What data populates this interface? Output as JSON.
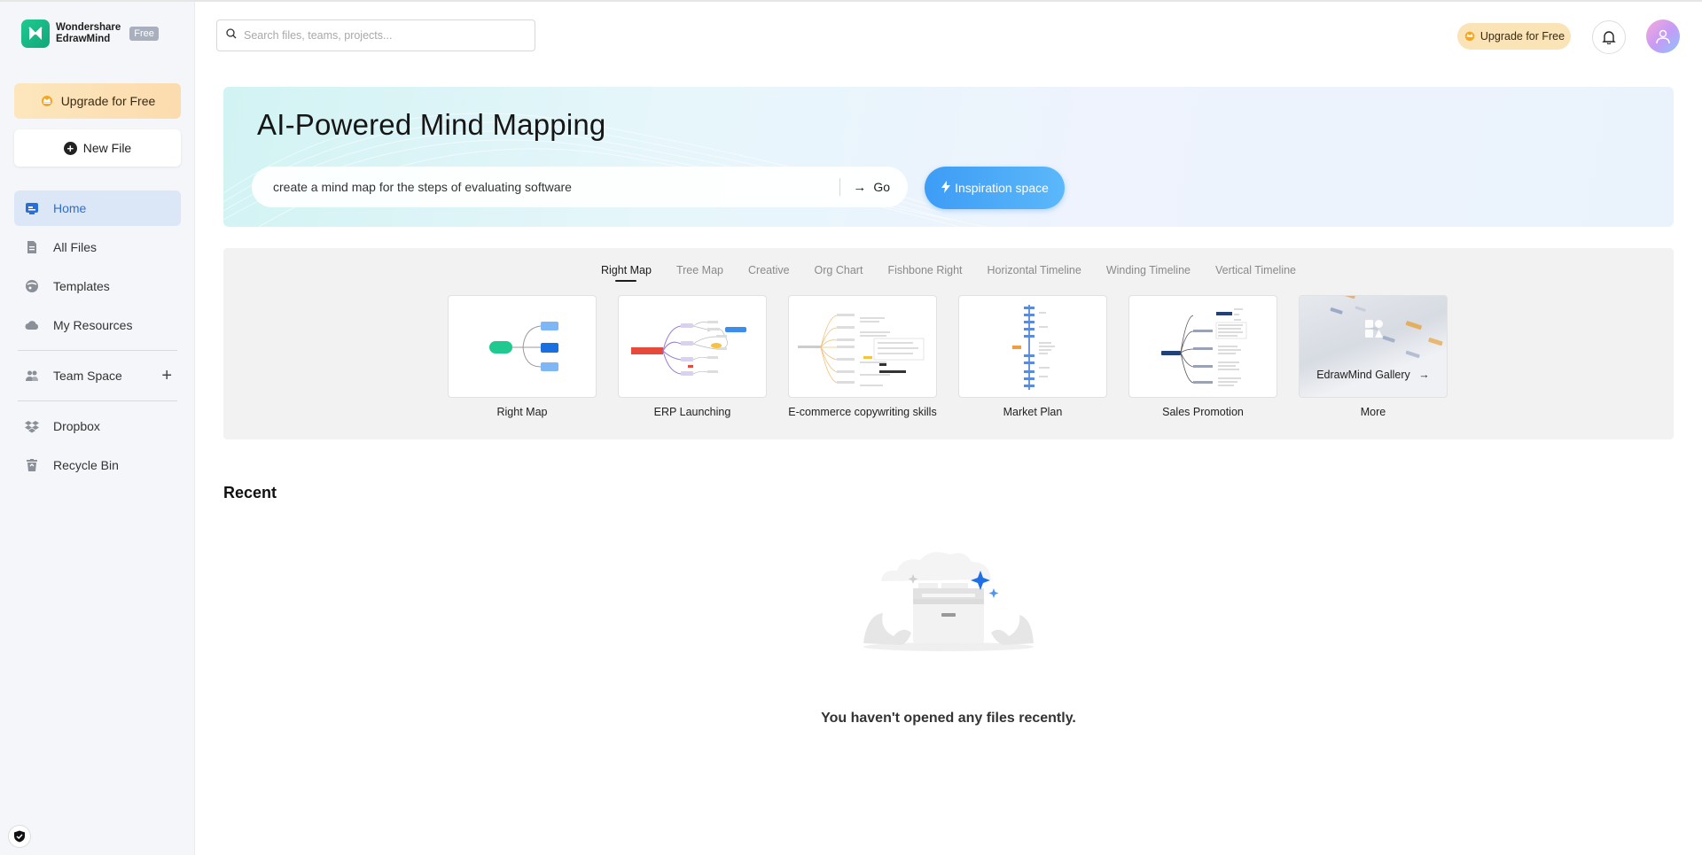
{
  "brand": {
    "line1": "Wondershare",
    "line2": "EdrawMind",
    "badge": "Free",
    "logo_icon": "edrawmind-logo-icon"
  },
  "sidebar": {
    "upgrade_label": "Upgrade for Free",
    "new_file_label": "New File",
    "nav": [
      {
        "label": "Home",
        "icon": "home-icon",
        "active": true
      },
      {
        "label": "All Files",
        "icon": "file-icon"
      },
      {
        "label": "Templates",
        "icon": "templates-icon"
      },
      {
        "label": "My Resources",
        "icon": "cloud-icon"
      }
    ],
    "team_space_label": "Team Space",
    "storage": [
      {
        "label": "Dropbox",
        "icon": "dropbox-icon"
      },
      {
        "label": "Recycle Bin",
        "icon": "recycle-bin-icon"
      }
    ]
  },
  "topbar": {
    "search_placeholder": "Search files, teams, projects...",
    "upgrade_label": "Upgrade for Free"
  },
  "hero": {
    "title": "AI-Powered Mind Mapping",
    "prompt_text": "create a mind map for the steps of evaluating software",
    "go_label": "Go",
    "inspiration_label": "Inspiration space"
  },
  "templates": {
    "tabs": [
      "Right Map",
      "Tree Map",
      "Creative",
      "Org Chart",
      "Fishbone Right",
      "Horizontal Timeline",
      "Winding Timeline",
      "Vertical Timeline"
    ],
    "active_tab": "Right Map",
    "cards": [
      {
        "label": "Right Map"
      },
      {
        "label": "ERP Launching"
      },
      {
        "label": "E-commerce copywriting skills"
      },
      {
        "label": "Market Plan"
      },
      {
        "label": "Sales Promotion"
      },
      {
        "label": "More",
        "overlay": "EdrawMind Gallery"
      }
    ]
  },
  "recent": {
    "title": "Recent",
    "empty_message": "You haven't opened any files recently."
  },
  "colors": {
    "accent": "#2a6fd6",
    "brand_green": "#1fc98f",
    "upgrade_bg": "#fbe3b8",
    "inspiration": "#3d9cf5"
  }
}
